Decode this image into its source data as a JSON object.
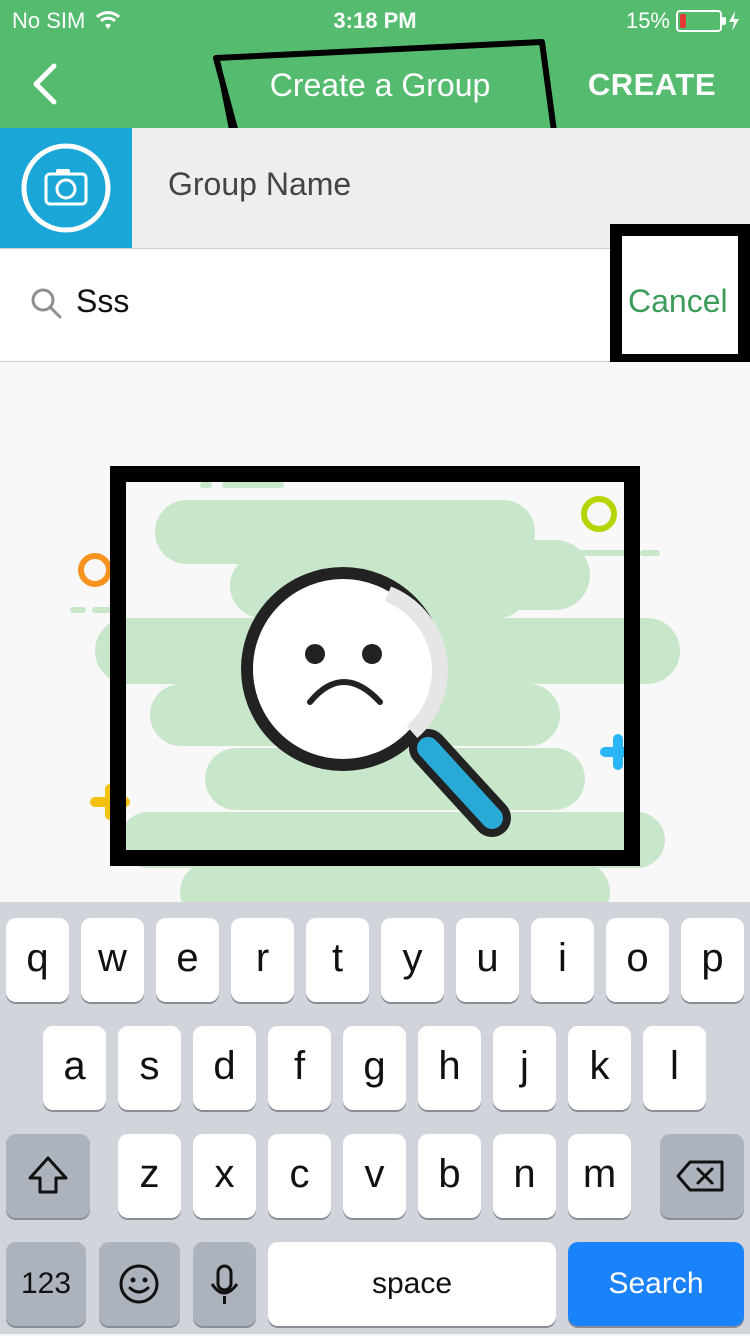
{
  "status_bar": {
    "carrier": "No SIM",
    "time": "3:18 PM",
    "battery": "15%"
  },
  "nav": {
    "title": "Create a Group",
    "action": "CREATE"
  },
  "group": {
    "name_placeholder": "Group Name"
  },
  "search": {
    "query": "Sss",
    "cancel_label": "Cancel"
  },
  "keyboard": {
    "row1": [
      "q",
      "w",
      "e",
      "r",
      "t",
      "y",
      "u",
      "i",
      "o",
      "p"
    ],
    "row2": [
      "a",
      "s",
      "d",
      "f",
      "g",
      "h",
      "j",
      "k",
      "l"
    ],
    "row3": [
      "z",
      "x",
      "c",
      "v",
      "b",
      "n",
      "m"
    ],
    "numbers_label": "123",
    "space_label": "space",
    "search_label": "Search"
  },
  "colors": {
    "header": "#54bb6f",
    "camera_bg": "#1aa7d8",
    "cancel": "#3d9b59",
    "search_key": "#1a82fb"
  }
}
